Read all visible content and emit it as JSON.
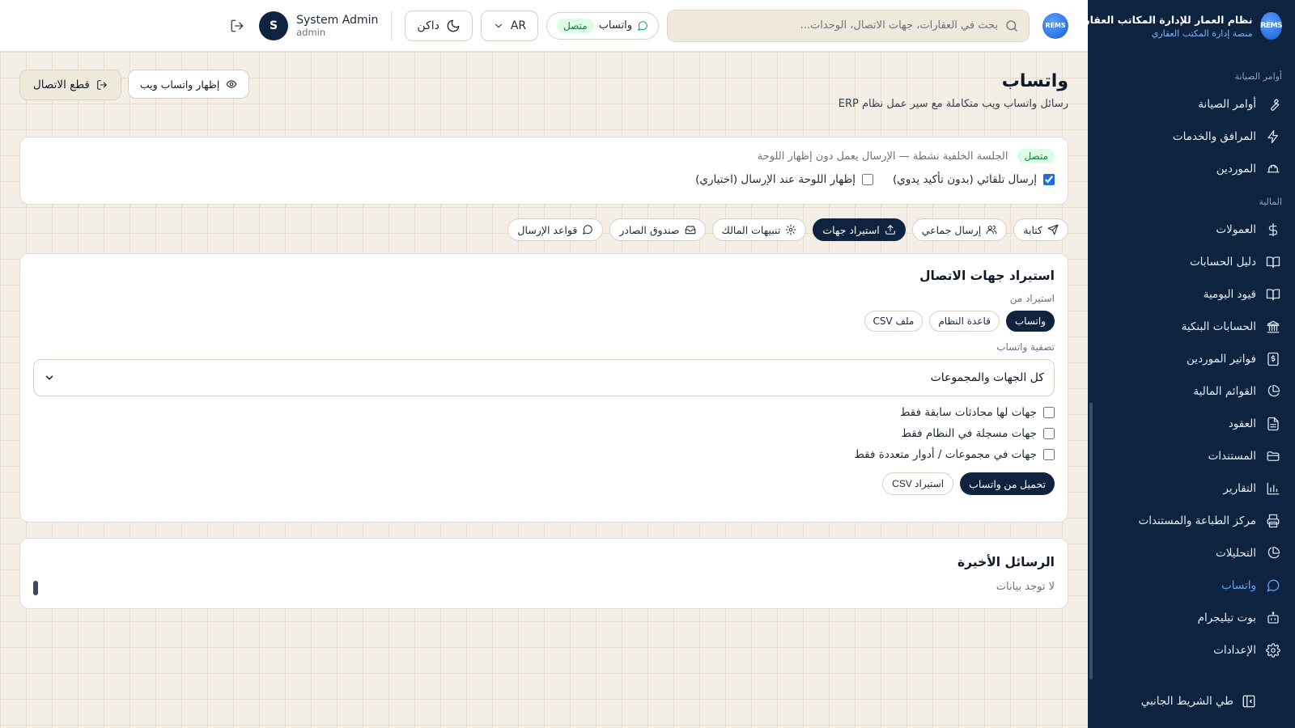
{
  "brand": {
    "logo_text": "REMS",
    "title": "نظام العمار للإدارة المكاتب العقارية",
    "subtitle": "منصة إدارة المكتب العقاري"
  },
  "sidebar": {
    "sections": [
      {
        "label": "أوامر الصيانة",
        "items": [
          {
            "label": "أوامر الصيانة",
            "icon": "wrench-icon"
          },
          {
            "label": "المرافق والخدمات",
            "icon": "bolt-icon"
          },
          {
            "label": "الموردين",
            "icon": "truck-icon"
          }
        ]
      },
      {
        "label": "المالية",
        "items": [
          {
            "label": "العمولات",
            "icon": "dollar-icon"
          },
          {
            "label": "دليل الحسابات",
            "icon": "book-icon"
          },
          {
            "label": "قيود اليومية",
            "icon": "book-icon"
          },
          {
            "label": "الحسابات البنكية",
            "icon": "bank-icon"
          },
          {
            "label": "فواتير الموردين",
            "icon": "invoice-icon"
          },
          {
            "label": "القوائم المالية",
            "icon": "pie-icon"
          },
          {
            "label": "العقود",
            "icon": "file-icon"
          },
          {
            "label": "المستندات",
            "icon": "folder-icon"
          },
          {
            "label": "التقارير",
            "icon": "bar-chart-icon"
          },
          {
            "label": "مركز الطباعة والمستندات",
            "icon": "printer-icon"
          },
          {
            "label": "التحليلات",
            "icon": "pie-icon"
          },
          {
            "label": "واتساب",
            "icon": "whatsapp-icon",
            "active": true
          },
          {
            "label": "بوت تيليجرام",
            "icon": "bot-icon"
          },
          {
            "label": "الإعدادات",
            "icon": "gear-icon"
          }
        ]
      }
    ],
    "collapse_label": "طي الشريط الجانبي"
  },
  "header": {
    "search_placeholder": "بحث في العقارات، جهات الاتصال، الوحدات...",
    "whatsapp_label": "واتساب",
    "whatsapp_status": "متصل",
    "language": "AR",
    "theme_label": "داكن",
    "user_name": "System Admin",
    "user_role": "admin",
    "avatar_initial": "S"
  },
  "page": {
    "title": "واتساب",
    "subtitle": "رسائل واتساب ويب متكاملة مع سير عمل نظام ERP",
    "show_web_label": "إظهار واتساب ويب",
    "disconnect_label": "قطع الاتصال"
  },
  "status": {
    "badge": "متصل",
    "text": "الجلسة الخلفية نشطة — الإرسال يعمل دون إظهار اللوحة",
    "auto_send_label": "إرسال تلقائي (بدون تأكيد يدوي)",
    "auto_send_checked": true,
    "show_panel_label": "إظهار اللوحة عند الإرسال (اختياري)",
    "show_panel_checked": false
  },
  "tabs": [
    {
      "label": "كتابة",
      "icon": "send-icon"
    },
    {
      "label": "إرسال جماعي",
      "icon": "users-icon"
    },
    {
      "label": "استيراد جهات",
      "icon": "upload-icon",
      "active": true
    },
    {
      "label": "تنبيهات المالك",
      "icon": "gear-icon"
    },
    {
      "label": "صندوق الصادر",
      "icon": "inbox-icon"
    },
    {
      "label": "قواعد الإرسال",
      "icon": "chat-icon"
    }
  ],
  "import": {
    "title": "استيراد جهات الاتصال",
    "source_label": "استيراد من",
    "sources": [
      {
        "label": "واتساب",
        "active": true
      },
      {
        "label": "قاعدة النظام"
      },
      {
        "label": "ملف CSV"
      }
    ],
    "filter_label": "تصفية واتساب",
    "filter_value": "كل الجهات والمجموعات",
    "options": [
      {
        "label": "جهات لها محادثات سابقة فقط",
        "checked": false
      },
      {
        "label": "جهات مسجلة في النظام فقط",
        "checked": false
      },
      {
        "label": "جهات في مجموعات / أدوار متعددة فقط",
        "checked": false
      }
    ],
    "load_label": "تحميل من واتساب",
    "csv_label": "استيراد CSV"
  },
  "recent": {
    "title": "الرسائل الأخيرة",
    "empty": "لا توجد بيانات"
  },
  "colors": {
    "navy": "#0d2340",
    "active_blue": "#5aa2ff",
    "success_green": "#15803d",
    "page_bg": "#f3efe6"
  }
}
